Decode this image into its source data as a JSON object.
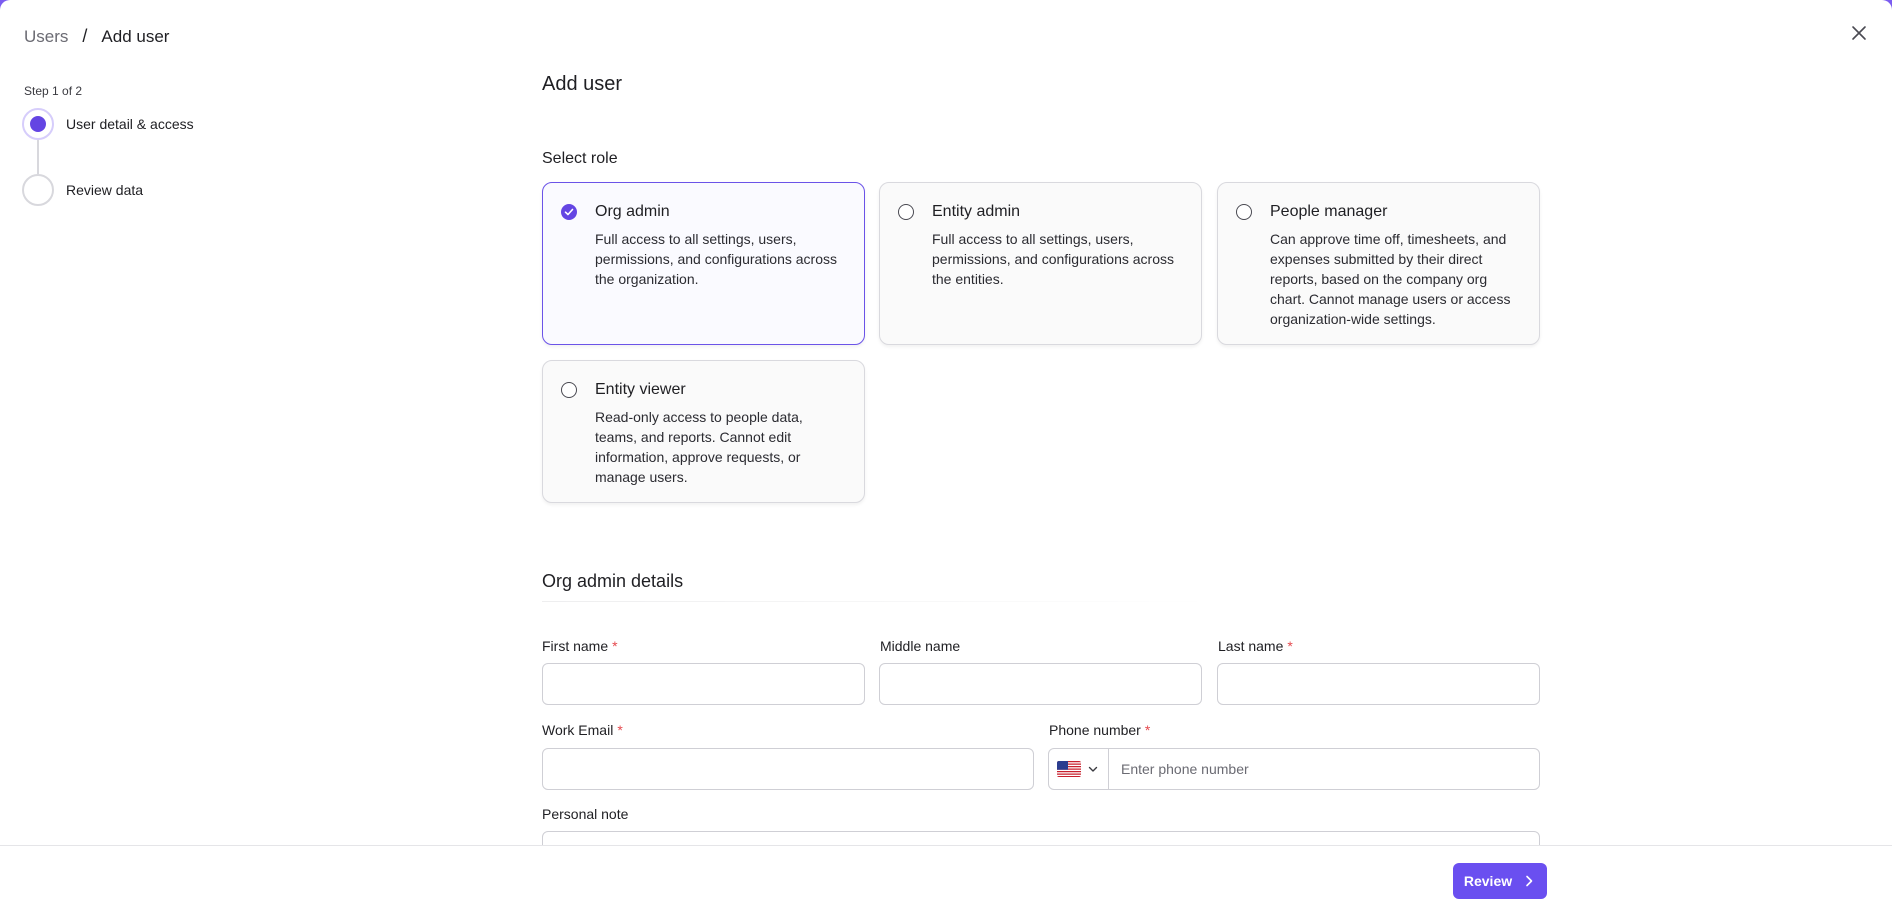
{
  "breadcrumb": {
    "parent": "Users",
    "separator": "/",
    "current": "Add user"
  },
  "stepper": {
    "caption": "Step 1 of 2",
    "steps": [
      {
        "label": "User detail & access",
        "state": "active"
      },
      {
        "label": "Review data",
        "state": "pending"
      }
    ]
  },
  "page": {
    "title": "Add user",
    "select_role_label": "Select role"
  },
  "roles": [
    {
      "title": "Org admin",
      "description": "Full access to all settings, users, permissions, and configurations across the organization.",
      "selected": true
    },
    {
      "title": "Entity admin",
      "description": "Full access to all settings, users, permissions, and configurations across the entities.",
      "selected": false
    },
    {
      "title": "People manager",
      "description": "Can approve time off, timesheets, and expenses submitted by their direct reports, based on the company org chart. Cannot manage users or access organization-wide settings.",
      "selected": false
    },
    {
      "title": "Entity viewer",
      "description": "Read-only access to people data, teams, and reports. Cannot edit information, approve requests, or manage users.",
      "selected": false
    }
  ],
  "details": {
    "title": "Org admin details",
    "required_marker": "*",
    "first_name": {
      "label": "First name",
      "value": ""
    },
    "middle_name": {
      "label": "Middle name",
      "value": ""
    },
    "last_name": {
      "label": "Last name",
      "value": ""
    },
    "work_email": {
      "label": "Work Email",
      "value": ""
    },
    "phone": {
      "label": "Phone number",
      "placeholder": "Enter phone number",
      "country": "us-flag-icon"
    },
    "personal_note": {
      "label": "Personal note"
    }
  },
  "footer": {
    "review_label": "Review"
  },
  "colors": {
    "accent": "#6445e3",
    "button": "#6a4ff0",
    "required": "#e5484d",
    "frame": "#7b5cf0"
  },
  "icons": {
    "close": "close-icon",
    "check": "check-icon",
    "chevron": "chevron-down-icon",
    "next": "chevron-right-icon"
  }
}
